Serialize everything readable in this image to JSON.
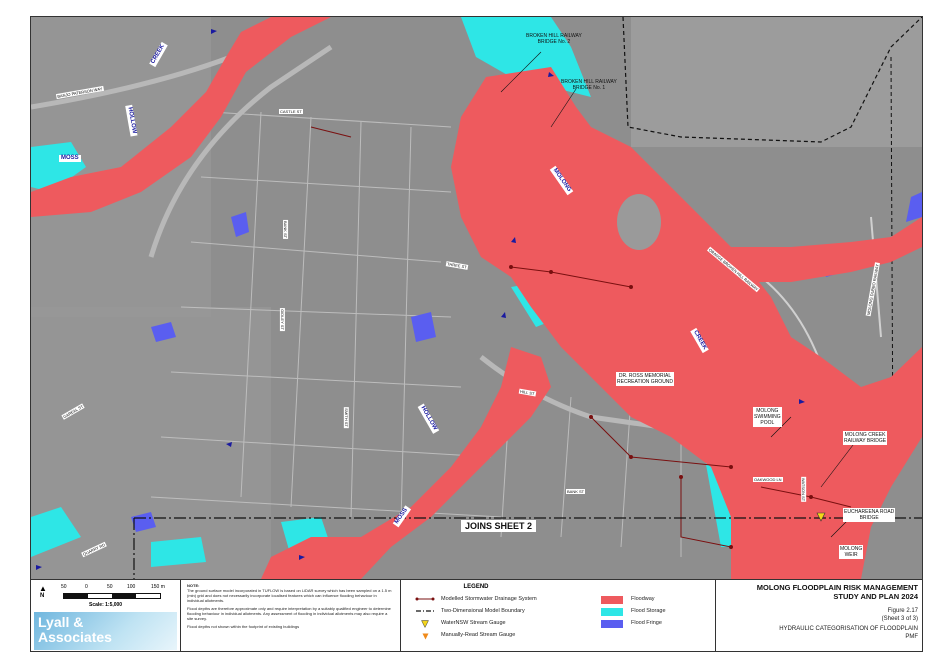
{
  "header": {
    "title_line1": "MOLONG FLOODPLAIN RISK MANAGEMENT",
    "title_line2": "STUDY AND PLAN 2024",
    "figure": "Figure 2.17",
    "sheet": "(Sheet 3 of 3)",
    "subtitle_line1": "HYDRAULIC CATEGORISATION OF FLOODPLAIN",
    "subtitle_line2": "PMF"
  },
  "scale": {
    "north": "N",
    "ticks": [
      "50",
      "0",
      "50",
      "100",
      "150 m"
    ],
    "label": "Scale: 1:5,000"
  },
  "logo": {
    "line1": "Lyall &",
    "line2": "Associates"
  },
  "note": {
    "title": "NOTE:",
    "p1": "The ground surface model incorporated in TUFLOW is based on LiDAR survey which has been sampled on a 1.5 m (min) grid and does not necessarily incorporate localised features which can influence flooding behaviour in individual allotments.",
    "p2": "Flood depths are therefore approximate only and require interpretation by a suitably qualified engineer to determine flooding behaviour in individual allotments. Any assessment of flooding in individual allotments may also require a site survey.",
    "p3": "Flood depths not shown within the footprint of existing buildings"
  },
  "legend": {
    "title": "LEGEND",
    "items": [
      {
        "label": "Modelled Stormwater Drainage System",
        "symbol": "drainage-line"
      },
      {
        "label": "Two-Dimensional Model Boundary",
        "symbol": "boundary-line"
      },
      {
        "label": "WaterNSW Stream Gauge",
        "symbol": "yellow-triangle"
      },
      {
        "label": "Manually-Read Stream Gauge",
        "symbol": "orange-triangle"
      }
    ],
    "categories": [
      {
        "label": "Floodway",
        "color": "#ee5a5e"
      },
      {
        "label": "Flood Storage",
        "color": "#2ee6e6"
      },
      {
        "label": "Flood Fringe",
        "color": "#5a5ef0"
      }
    ]
  },
  "map": {
    "joins": "JOINS SHEET 2",
    "creeks": [
      {
        "text": "MOSS"
      },
      {
        "text": "HOLLOW"
      },
      {
        "text": "CREEK"
      },
      {
        "text": "MOLONG"
      },
      {
        "text": "CREEK"
      },
      {
        "text": "HOLLOW"
      },
      {
        "text": "MOSS"
      }
    ],
    "callouts": {
      "bhr2": "BROKEN HILL RAILWAY\nBRIDGE No. 2",
      "bhr1": "BROKEN HILL RAILWAY\nBRIDGE No. 1",
      "dross": "DR. ROSS MEMORIAL\nRECREATION GROUND",
      "pool": "MOLONG\nSWIMMING\nPOOL",
      "mcrb": "MOLONG CREEK\nRAILWAY BRIDGE",
      "eucha": "EUCHAREENA ROAD\nBRIDGE",
      "weir": "MOLONG\nWEIR"
    },
    "streets": [
      "BANJO PATERSON WAY",
      "CASTLE ST",
      "THREE ST",
      "HILL ST",
      "GAREAL ST",
      "QUARRY RD",
      "BANK ST",
      "GIDLEY ST",
      "WATSON ST",
      "SMITH ST",
      "OAKWOOD LN",
      "ORANGE BROKEN HILL RAILWAY",
      "MOLONG DUBBO RAILWAY",
      "BANK ST"
    ]
  }
}
